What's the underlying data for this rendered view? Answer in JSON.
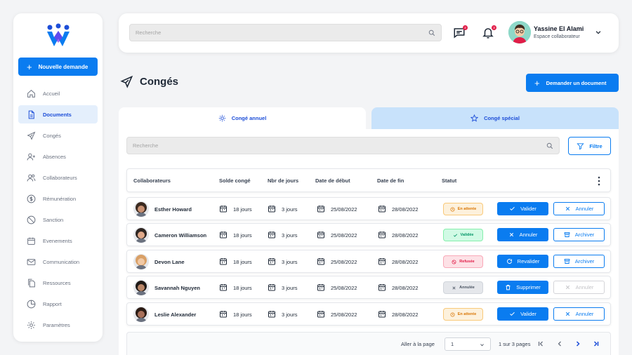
{
  "sidebar": {
    "new_request": "Nouvelle demande",
    "items": [
      {
        "label": "Accueil",
        "icon": "home-icon"
      },
      {
        "label": "Documents",
        "icon": "document-icon",
        "active": true
      },
      {
        "label": "Congés",
        "icon": "plane-icon"
      },
      {
        "label": "Absences",
        "icon": "user-plus-icon"
      },
      {
        "label": "Collaborateurs",
        "icon": "users-icon"
      },
      {
        "label": "Rémunération",
        "icon": "dollar-icon"
      },
      {
        "label": "Sanction",
        "icon": "ban-icon"
      },
      {
        "label": "Evenements",
        "icon": "calendar-icon"
      },
      {
        "label": "Communication",
        "icon": "mail-icon"
      },
      {
        "label": "Ressources",
        "icon": "files-icon"
      },
      {
        "label": "Rapport",
        "icon": "pie-chart-icon"
      },
      {
        "label": "Paramètres",
        "icon": "gear-icon"
      }
    ]
  },
  "header": {
    "search_placeholder": "Recherche",
    "messages_count": "2",
    "notifications_count": "3",
    "user_name": "Yassine El Alami",
    "user_role": "Espace collaborateur"
  },
  "page": {
    "title": "Congés",
    "request_button": "Demander un document"
  },
  "tabs": [
    {
      "label": "Congé annuel",
      "icon": "sun-icon",
      "active": true
    },
    {
      "label": "Congé spécial",
      "icon": "star-icon",
      "active": false
    }
  ],
  "table": {
    "search_placeholder": "Recherche",
    "filter_label": "Filtre",
    "columns": [
      "Collaborateurs",
      "Solde congé",
      "Nbr de jours",
      "Date de début",
      "Date de fin",
      "Statut"
    ],
    "rows": [
      {
        "name": "Esther Howard",
        "solde": "18 jours",
        "jours": "3 jours",
        "debut": "25/08/2022",
        "fin": "28/08/2022",
        "status": "En attente",
        "status_kind": "wait",
        "action1": "Valider",
        "action1_kind": "primary",
        "action2": "Annuler",
        "action2_kind": "outline"
      },
      {
        "name": "Cameron Williamson",
        "solde": "18 jours",
        "jours": "3 jours",
        "debut": "25/08/2022",
        "fin": "28/08/2022",
        "status": "Validée",
        "status_kind": "ok",
        "action1": "Annuler",
        "action1_kind": "primary",
        "action2": "Archiver",
        "action2_kind": "outline"
      },
      {
        "name": "Devon Lane",
        "solde": "18 jours",
        "jours": "3 jours",
        "debut": "25/08/2022",
        "fin": "28/08/2022",
        "status": "Refusée",
        "status_kind": "ref",
        "action1": "Revalider",
        "action1_kind": "primary",
        "action2": "Archiver",
        "action2_kind": "outline"
      },
      {
        "name": "Savannah Nguyen",
        "solde": "18 jours",
        "jours": "3 jours",
        "debut": "25/08/2022",
        "fin": "28/08/2022",
        "status": "Annulée",
        "status_kind": "ann",
        "action1": "Supprimer",
        "action1_kind": "primary",
        "action2": "Annuler",
        "action2_kind": "disabled"
      },
      {
        "name": "Leslie Alexander",
        "solde": "18 jours",
        "jours": "3 jours",
        "debut": "25/08/2022",
        "fin": "28/08/2022",
        "status": "En attente",
        "status_kind": "wait",
        "action1": "Valider",
        "action1_kind": "primary",
        "action2": "Annuler",
        "action2_kind": "outline"
      }
    ]
  },
  "pagination": {
    "goto_label": "Aller à la page",
    "current_page": "1",
    "pages_text": "1 sur 3 pages"
  },
  "colors": {
    "accent": "#0a7cf0",
    "tab_inactive": "#c8e2fb",
    "danger": "#e11d48"
  }
}
